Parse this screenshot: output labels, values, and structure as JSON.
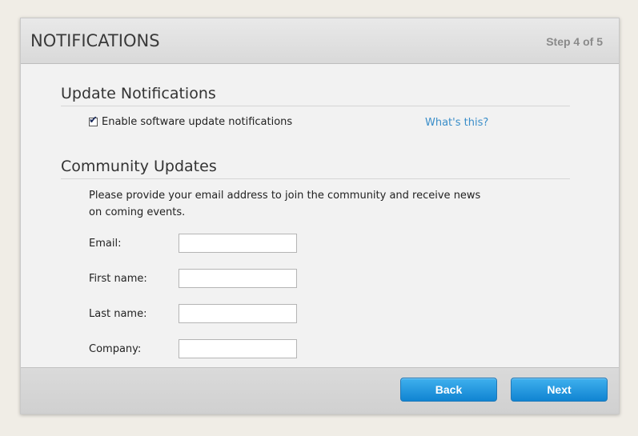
{
  "header": {
    "title": "NOTIFICATIONS",
    "step": "Step 4 of 5"
  },
  "update_notifications": {
    "title": "Update Notifications",
    "checkbox_label": "Enable software update notifications",
    "checkbox_checked": true,
    "help_link": "What's this?"
  },
  "community_updates": {
    "title": "Community Updates",
    "intro": "Please provide your email address to join the community and receive news on coming events.",
    "fields": [
      {
        "label": "Email:",
        "value": ""
      },
      {
        "label": "First name:",
        "value": ""
      },
      {
        "label": "Last name:",
        "value": ""
      },
      {
        "label": "Company:",
        "value": ""
      }
    ]
  },
  "footer": {
    "back_label": "Back",
    "next_label": "Next"
  },
  "colors": {
    "accent_button": "#1a8fd8",
    "link": "#3a8ec9"
  },
  "icons": {
    "checkbox": "checkmark-icon"
  }
}
